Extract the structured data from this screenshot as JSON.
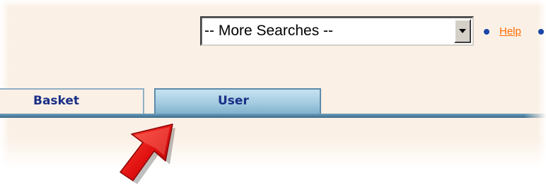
{
  "search": {
    "select_value": "-- More Searches --"
  },
  "header_links": {
    "help_label": "Help"
  },
  "tabs": [
    {
      "label": "Basket",
      "active": false
    },
    {
      "label": "User",
      "active": true
    }
  ],
  "icons": {
    "pointer": "red-pointer-arrow-icon",
    "bullet": "blue-bullet-icon",
    "dropdown": "chevron-down-icon"
  },
  "colors": {
    "panel_background": "#fbf0e6",
    "tab_text": "#1b2f86",
    "link": "#ff6a00",
    "bullet": "#1a46a8",
    "active_tab": "#a3cbe0",
    "tab_rule": "#4e7f9f",
    "pointer": "#e01010"
  }
}
